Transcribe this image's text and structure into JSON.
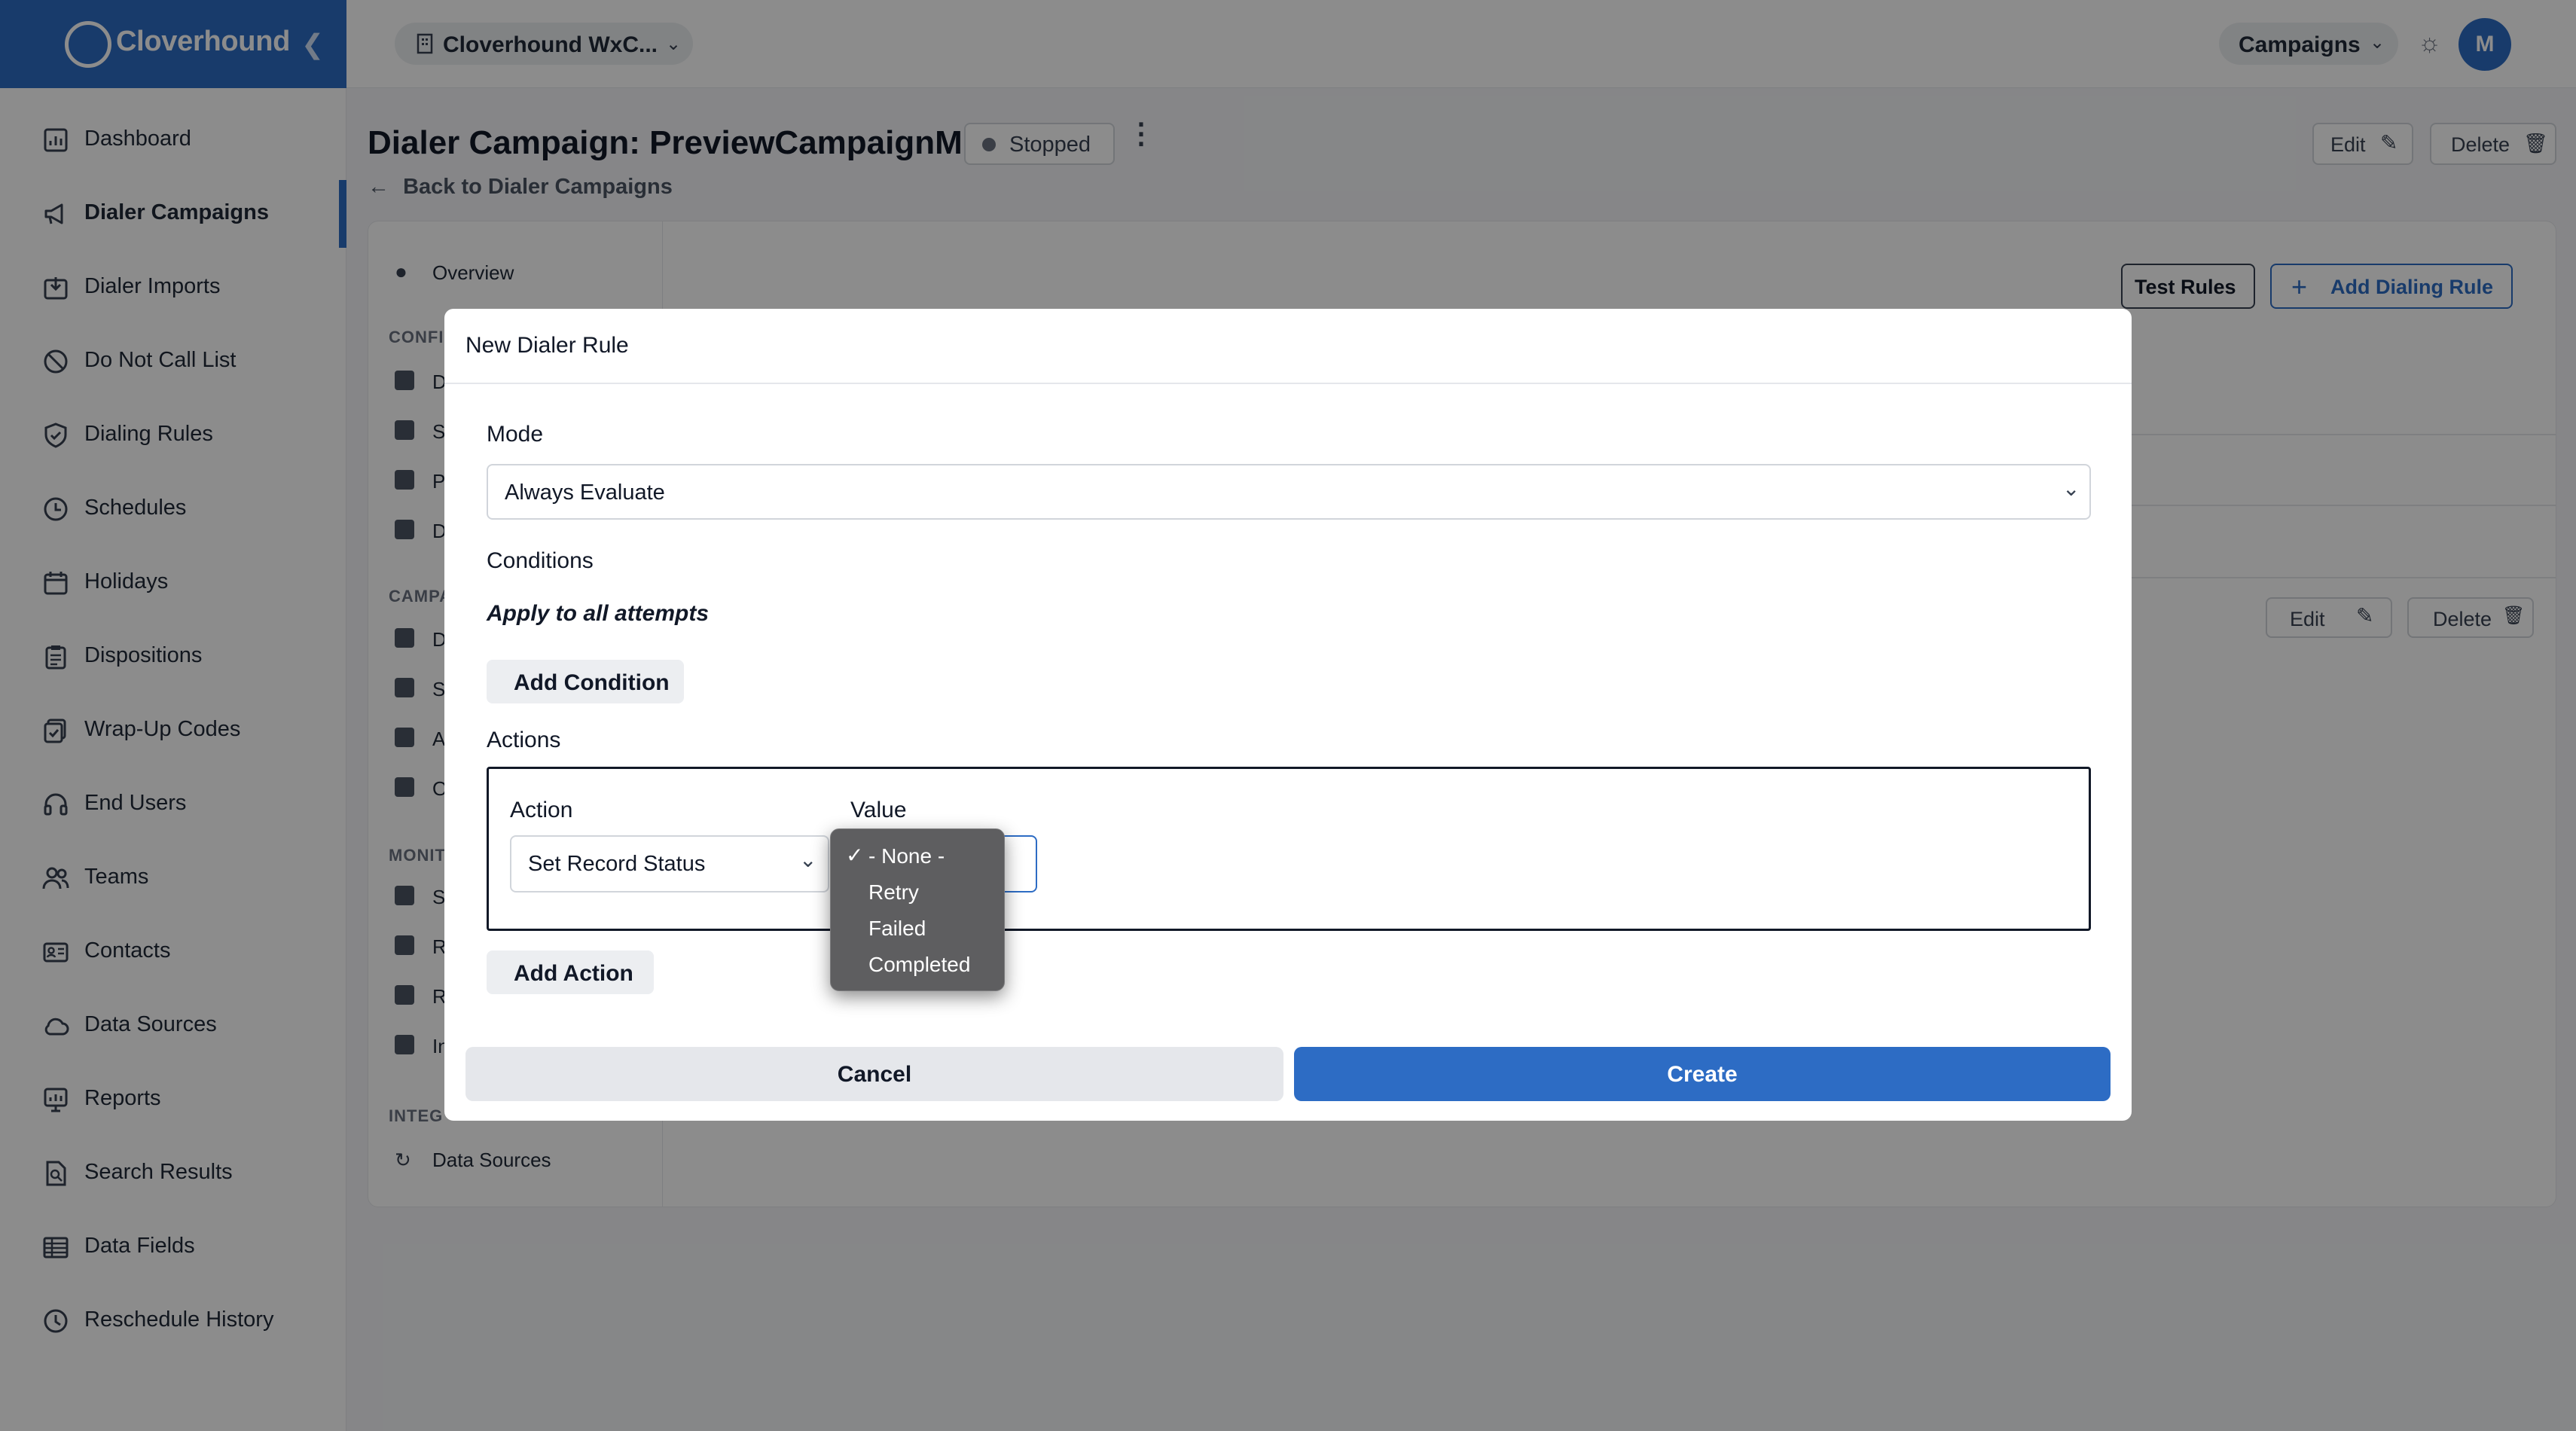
{
  "app": {
    "name": "Cloverhound"
  },
  "sidebar": {
    "items": [
      {
        "label": "Dashboard",
        "icon": "dashboard-icon"
      },
      {
        "label": "Dialer Campaigns",
        "icon": "megaphone-icon",
        "active": true
      },
      {
        "label": "Dialer Imports",
        "icon": "import-icon"
      },
      {
        "label": "Do Not Call List",
        "icon": "prohibited-icon"
      },
      {
        "label": "Dialing Rules",
        "icon": "shield-icon"
      },
      {
        "label": "Schedules",
        "icon": "clock-icon"
      },
      {
        "label": "Holidays",
        "icon": "calendar-icon"
      },
      {
        "label": "Dispositions",
        "icon": "clipboard-icon"
      },
      {
        "label": "Wrap-Up Codes",
        "icon": "wrapup-icon"
      },
      {
        "label": "End Users",
        "icon": "headset-icon"
      },
      {
        "label": "Teams",
        "icon": "team-icon"
      },
      {
        "label": "Contacts",
        "icon": "contact-card-icon"
      },
      {
        "label": "Data Sources",
        "icon": "cloud-icon"
      },
      {
        "label": "Reports",
        "icon": "report-icon"
      },
      {
        "label": "Search Results",
        "icon": "search-document-icon"
      },
      {
        "label": "Data Fields",
        "icon": "table-icon"
      },
      {
        "label": "Reschedule History",
        "icon": "history-icon"
      }
    ]
  },
  "topbar": {
    "org_selector": "Cloverhound WxC...",
    "module_selector": "Campaigns",
    "avatar_initial": "M"
  },
  "page": {
    "title": "Dialer Campaign: PreviewCampaignM",
    "status": "Stopped",
    "edit_label": "Edit",
    "delete_label": "Delete",
    "back_link": "Back to Dialer Campaigns",
    "test_rules_label": "Test Rules",
    "add_dialing_rule_label": "Add Dialing Rule",
    "row_edit_label": "Edit",
    "row_delete_label": "Delete"
  },
  "subnav": {
    "overview": "Overview",
    "section_config": "CONFI",
    "section_campaign": "CAMPA",
    "section_monitor": "MONIT",
    "section_integrations": "INTEG",
    "partial_items": [
      "D",
      "S",
      "P",
      "D",
      "D",
      "S",
      "A",
      "O",
      "S",
      "R",
      "R",
      "In"
    ],
    "data_sources": "Data Sources"
  },
  "modal": {
    "title": "New Dialer Rule",
    "mode_label": "Mode",
    "mode_value": "Always Evaluate",
    "conditions_label": "Conditions",
    "conditions_note": "Apply to all attempts",
    "add_condition_label": "Add Condition",
    "actions_label": "Actions",
    "action_col_label": "Action",
    "value_col_label": "Value",
    "action_value": "Set Record Status",
    "add_action_label": "Add Action",
    "cancel_label": "Cancel",
    "create_label": "Create"
  },
  "dropdown": {
    "options": [
      "- None -",
      "Retry",
      "Failed",
      "Completed"
    ],
    "selected": "- None -"
  },
  "colors": {
    "accent": "#2d6cc4",
    "overlay": "rgba(0,0,0,0.45)"
  }
}
